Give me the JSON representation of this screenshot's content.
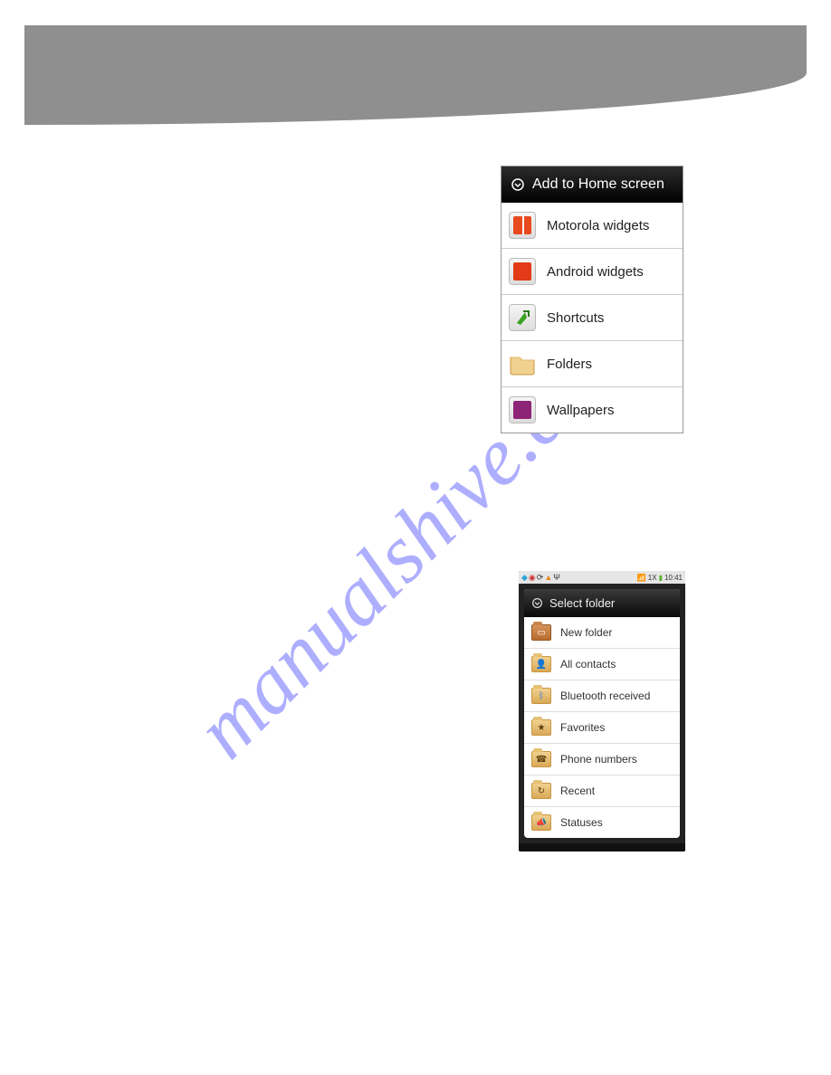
{
  "watermark": "manualshive.com",
  "menu1": {
    "title": "Add to Home screen",
    "items": [
      {
        "label": "Motorola widgets",
        "icon": "motorola-widgets-icon"
      },
      {
        "label": "Android widgets",
        "icon": "android-widgets-icon"
      },
      {
        "label": "Shortcuts",
        "icon": "shortcuts-icon"
      },
      {
        "label": "Folders",
        "icon": "folders-icon"
      },
      {
        "label": "Wallpapers",
        "icon": "wallpapers-icon"
      }
    ]
  },
  "phone": {
    "status": {
      "signal": "1X",
      "time": "10:41"
    },
    "menu2": {
      "title": "Select folder",
      "items": [
        {
          "label": "New folder",
          "glyph": ""
        },
        {
          "label": "All contacts",
          "glyph": "👤"
        },
        {
          "label": "Bluetooth received",
          "glyph": "ᛒ"
        },
        {
          "label": "Favorites",
          "glyph": "★"
        },
        {
          "label": "Phone numbers",
          "glyph": "☎"
        },
        {
          "label": "Recent",
          "glyph": "↻"
        },
        {
          "label": "Statuses",
          "glyph": "📣"
        }
      ]
    }
  }
}
